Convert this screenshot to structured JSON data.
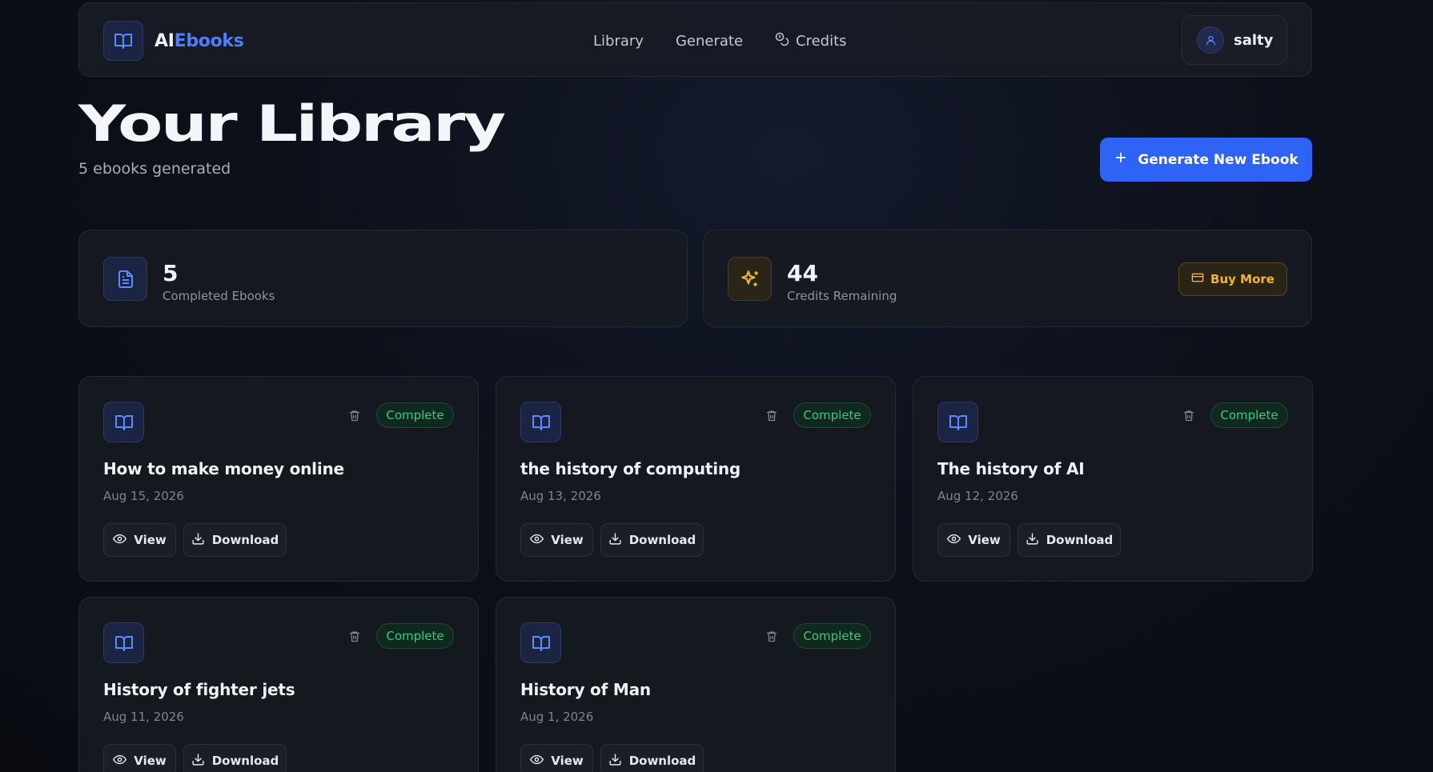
{
  "brand": {
    "prefix": "AI",
    "suffix": "Ebooks"
  },
  "nav": {
    "library": "Library",
    "generate": "Generate",
    "credits": "Credits"
  },
  "user": {
    "name": "salty"
  },
  "header": {
    "title": "Your Library",
    "subtitle": "5 ebooks generated",
    "generate_button": "Generate New Ebook"
  },
  "stats": {
    "completed": {
      "value": "5",
      "label": "Completed Ebooks"
    },
    "credits": {
      "value": "44",
      "label": "Credits Remaining",
      "buy_label": "Buy More"
    }
  },
  "ebooks": [
    {
      "title": "How to make money online",
      "date": "Aug 15, 2026",
      "status": "Complete"
    },
    {
      "title": "the history of computing",
      "date": "Aug 13, 2026",
      "status": "Complete"
    },
    {
      "title": "The history of AI",
      "date": "Aug 12, 2026",
      "status": "Complete"
    },
    {
      "title": "History of fighter jets",
      "date": "Aug 11, 2026",
      "status": "Complete"
    },
    {
      "title": "History of Man",
      "date": "Aug 1, 2026",
      "status": "Complete"
    }
  ],
  "card_actions": {
    "view": "View",
    "download": "Download"
  },
  "colors": {
    "accent": "#2f63f5",
    "brand_blue": "#4f7dff",
    "success": "#34c98a",
    "gold": "#f2b53a"
  }
}
